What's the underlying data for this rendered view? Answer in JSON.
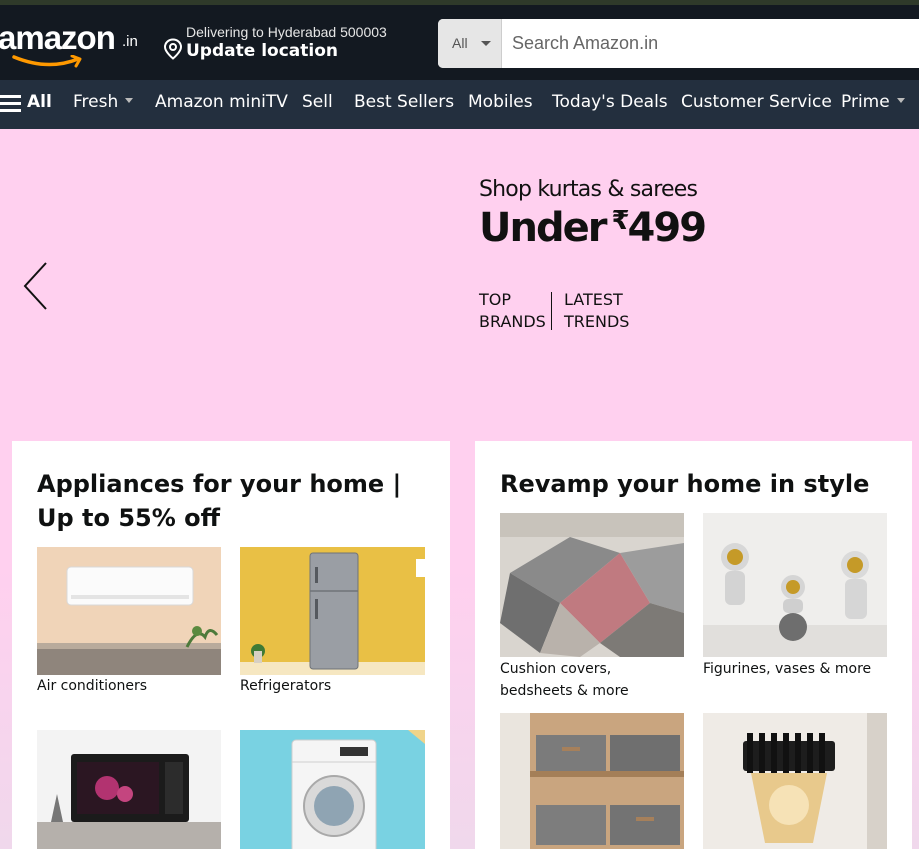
{
  "header": {
    "logo_text": "amazon",
    "logo_tld": ".in",
    "delivery_line1": "Delivering to Hyderabad 500003",
    "delivery_line2": "Update location",
    "search_category": "All",
    "search_placeholder": "Search Amazon.in"
  },
  "nav": {
    "items": [
      {
        "label": "All"
      },
      {
        "label": "Fresh"
      },
      {
        "label": "Amazon miniTV"
      },
      {
        "label": "Sell"
      },
      {
        "label": "Best Sellers"
      },
      {
        "label": "Mobiles"
      },
      {
        "label": "Today's Deals"
      },
      {
        "label": "Customer Service"
      },
      {
        "label": "Prime"
      }
    ]
  },
  "hero": {
    "subtitle": "Shop kurtas & sarees",
    "headline": "Under",
    "currency": "₹",
    "price": "499",
    "tag1_line1": "TOP",
    "tag1_line2": "BRANDS",
    "tag2_line1": "LATEST",
    "tag2_line2": "TRENDS"
  },
  "cards": [
    {
      "title": "Appliances for your home | Up to 55% off",
      "tiles": [
        {
          "caption": "Air conditioners"
        },
        {
          "caption": "Refrigerators"
        },
        {
          "caption": ""
        },
        {
          "caption": ""
        }
      ]
    },
    {
      "title": "Revamp your home in style",
      "tiles": [
        {
          "caption": "Cushion covers, bedsheets & more"
        },
        {
          "caption": "Figurines, vases & more"
        },
        {
          "caption": ""
        },
        {
          "caption": ""
        }
      ]
    }
  ],
  "colors": {
    "header_bg": "#131921",
    "nav_bg": "#232f3e",
    "hero_bg": "#ffd0ef",
    "logo_smile": "#ff9900"
  }
}
